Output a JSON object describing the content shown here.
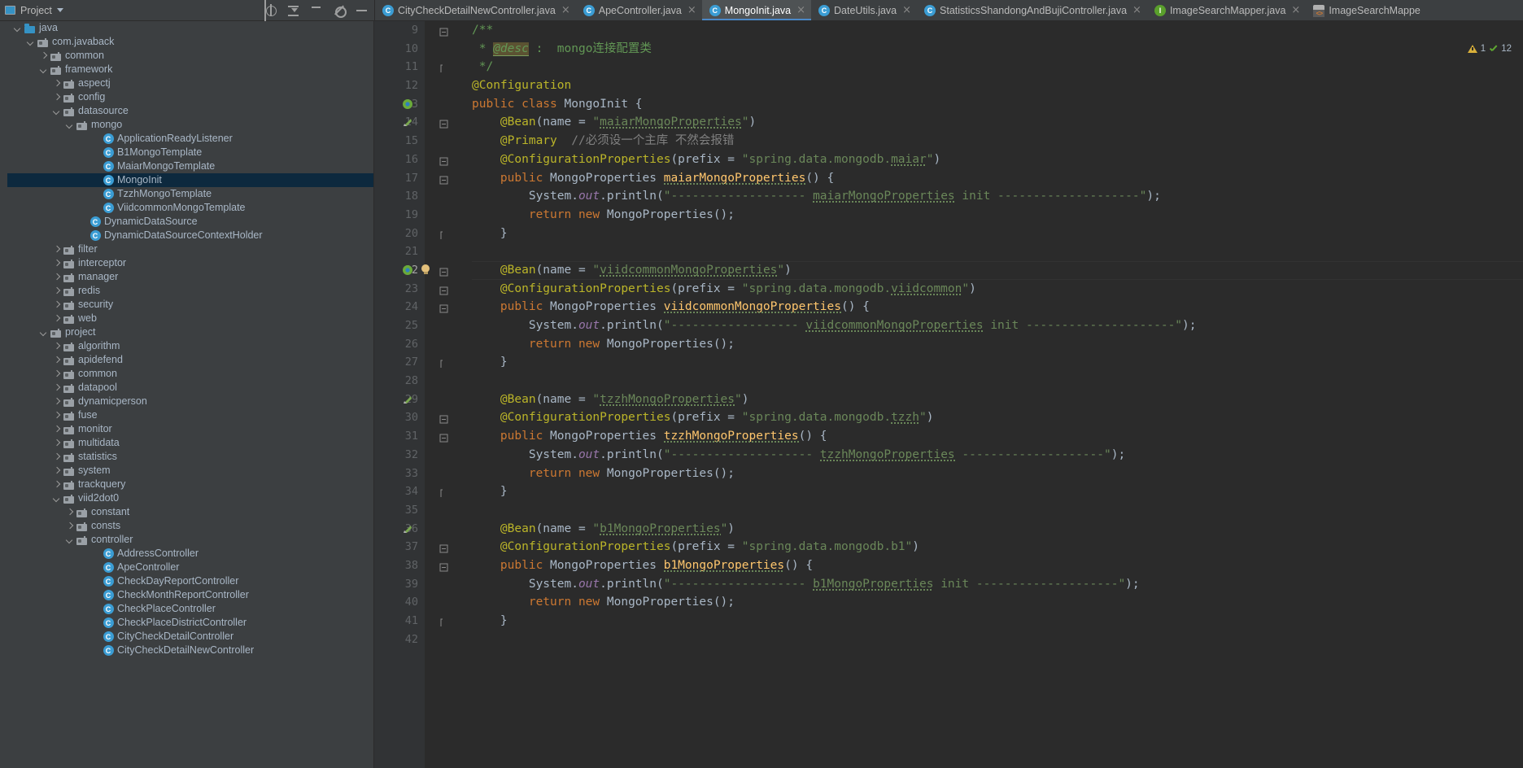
{
  "window": {
    "project_panel_title": "Project",
    "panel_icons": [
      "project-icon",
      "chevron-down-icon",
      "locate-icon",
      "collapse-all-icon",
      "sort-icon",
      "settings-gear-icon",
      "hide-icon"
    ]
  },
  "tabs": [
    {
      "label": "CityCheckDetailNewController.java",
      "icon": "class-icon",
      "icon_kind": "cls",
      "active": false
    },
    {
      "label": "ApeController.java",
      "icon": "class-icon",
      "icon_kind": "cls",
      "active": false
    },
    {
      "label": "MongoInit.java",
      "icon": "class-icon",
      "icon_kind": "cls",
      "active": true
    },
    {
      "label": "DateUtils.java",
      "icon": "class-icon",
      "icon_kind": "cls",
      "active": false
    },
    {
      "label": "StatisticsShandongAndBujiController.java",
      "icon": "class-icon",
      "icon_kind": "cls",
      "active": false
    },
    {
      "label": "ImageSearchMapper.java",
      "icon": "interface-icon",
      "icon_kind": "iface",
      "active": false
    },
    {
      "label": "ImageSearchMappe",
      "icon": "xml-file-icon",
      "icon_kind": "xml",
      "active": false
    }
  ],
  "inspection": {
    "warnings": "1",
    "checks": "12"
  },
  "tree": [
    {
      "label": "java",
      "indent": 3,
      "arrow": "down",
      "icon": "folder-src",
      "sel": false
    },
    {
      "label": "com.javaback",
      "indent": 4,
      "arrow": "down",
      "icon": "folder-pkg",
      "sel": false
    },
    {
      "label": "common",
      "indent": 5,
      "arrow": "right",
      "icon": "folder-pkg",
      "sel": false
    },
    {
      "label": "framework",
      "indent": 5,
      "arrow": "down",
      "icon": "folder-pkg",
      "sel": false
    },
    {
      "label": "aspectj",
      "indent": 6,
      "arrow": "right",
      "icon": "folder-pkg",
      "sel": false
    },
    {
      "label": "config",
      "indent": 6,
      "arrow": "right",
      "icon": "folder-pkg",
      "sel": false
    },
    {
      "label": "datasource",
      "indent": 6,
      "arrow": "down",
      "icon": "folder-pkg",
      "sel": false
    },
    {
      "label": "mongo",
      "indent": 7,
      "arrow": "down",
      "icon": "folder-pkg",
      "sel": false
    },
    {
      "label": "ApplicationReadyListener",
      "indent": 9,
      "arrow": "none",
      "icon": "class",
      "sel": false
    },
    {
      "label": "B1MongoTemplate",
      "indent": 9,
      "arrow": "none",
      "icon": "class",
      "sel": false
    },
    {
      "label": "MaiarMongoTemplate",
      "indent": 9,
      "arrow": "none",
      "icon": "class",
      "sel": false
    },
    {
      "label": "MongoInit",
      "indent": 9,
      "arrow": "none",
      "icon": "class",
      "sel": true
    },
    {
      "label": "TzzhMongoTemplate",
      "indent": 9,
      "arrow": "none",
      "icon": "class",
      "sel": false
    },
    {
      "label": "ViidcommonMongoTemplate",
      "indent": 9,
      "arrow": "none",
      "icon": "class",
      "sel": false
    },
    {
      "label": "DynamicDataSource",
      "indent": 8,
      "arrow": "none",
      "icon": "class",
      "sel": false
    },
    {
      "label": "DynamicDataSourceContextHolder",
      "indent": 8,
      "arrow": "none",
      "icon": "class",
      "sel": false
    },
    {
      "label": "filter",
      "indent": 6,
      "arrow": "right",
      "icon": "folder-pkg",
      "sel": false
    },
    {
      "label": "interceptor",
      "indent": 6,
      "arrow": "right",
      "icon": "folder-pkg",
      "sel": false
    },
    {
      "label": "manager",
      "indent": 6,
      "arrow": "right",
      "icon": "folder-pkg",
      "sel": false
    },
    {
      "label": "redis",
      "indent": 6,
      "arrow": "right",
      "icon": "folder-pkg",
      "sel": false
    },
    {
      "label": "security",
      "indent": 6,
      "arrow": "right",
      "icon": "folder-pkg",
      "sel": false
    },
    {
      "label": "web",
      "indent": 6,
      "arrow": "right",
      "icon": "folder-pkg",
      "sel": false
    },
    {
      "label": "project",
      "indent": 5,
      "arrow": "down",
      "icon": "folder-pkg",
      "sel": false
    },
    {
      "label": "algorithm",
      "indent": 6,
      "arrow": "right",
      "icon": "folder-pkg",
      "sel": false
    },
    {
      "label": "apidefend",
      "indent": 6,
      "arrow": "right",
      "icon": "folder-pkg",
      "sel": false
    },
    {
      "label": "common",
      "indent": 6,
      "arrow": "right",
      "icon": "folder-pkg",
      "sel": false
    },
    {
      "label": "datapool",
      "indent": 6,
      "arrow": "right",
      "icon": "folder-pkg",
      "sel": false
    },
    {
      "label": "dynamicperson",
      "indent": 6,
      "arrow": "right",
      "icon": "folder-pkg",
      "sel": false
    },
    {
      "label": "fuse",
      "indent": 6,
      "arrow": "right",
      "icon": "folder-pkg",
      "sel": false
    },
    {
      "label": "monitor",
      "indent": 6,
      "arrow": "right",
      "icon": "folder-pkg",
      "sel": false
    },
    {
      "label": "multidata",
      "indent": 6,
      "arrow": "right",
      "icon": "folder-pkg",
      "sel": false
    },
    {
      "label": "statistics",
      "indent": 6,
      "arrow": "right",
      "icon": "folder-pkg",
      "sel": false
    },
    {
      "label": "system",
      "indent": 6,
      "arrow": "right",
      "icon": "folder-pkg",
      "sel": false
    },
    {
      "label": "trackquery",
      "indent": 6,
      "arrow": "right",
      "icon": "folder-pkg",
      "sel": false
    },
    {
      "label": "viid2dot0",
      "indent": 6,
      "arrow": "down",
      "icon": "folder-pkg",
      "sel": false
    },
    {
      "label": "constant",
      "indent": 7,
      "arrow": "right",
      "icon": "folder-pkg",
      "sel": false
    },
    {
      "label": "consts",
      "indent": 7,
      "arrow": "right",
      "icon": "folder-pkg",
      "sel": false
    },
    {
      "label": "controller",
      "indent": 7,
      "arrow": "down",
      "icon": "folder-pkg",
      "sel": false
    },
    {
      "label": "AddressController",
      "indent": 9,
      "arrow": "none",
      "icon": "class",
      "sel": false
    },
    {
      "label": "ApeController",
      "indent": 9,
      "arrow": "none",
      "icon": "class",
      "sel": false
    },
    {
      "label": "CheckDayReportController",
      "indent": 9,
      "arrow": "none",
      "icon": "class",
      "sel": false
    },
    {
      "label": "CheckMonthReportController",
      "indent": 9,
      "arrow": "none",
      "icon": "class",
      "sel": false
    },
    {
      "label": "CheckPlaceController",
      "indent": 9,
      "arrow": "none",
      "icon": "class",
      "sel": false
    },
    {
      "label": "CheckPlaceDistrictController",
      "indent": 9,
      "arrow": "none",
      "icon": "class",
      "sel": false
    },
    {
      "label": "CityCheckDetailController",
      "indent": 9,
      "arrow": "none",
      "icon": "class",
      "sel": false
    },
    {
      "label": "CityCheckDetailNewController",
      "indent": 9,
      "arrow": "none",
      "icon": "class",
      "sel": false
    }
  ],
  "editor": {
    "file": "MongoInit.java",
    "first_line": 9,
    "lines": [
      {
        "n": 9,
        "fold": "top",
        "marker": "",
        "html": "<span class=\"doc\">/**</span>"
      },
      {
        "n": 10,
        "fold": "",
        "marker": "",
        "html": "<span class=\"doc\"> * </span><span class=\"hl-doctag\">@desc</span><span class=\"doc\"> :  mongo连接配置类</span>"
      },
      {
        "n": 11,
        "fold": "bottom",
        "marker": "",
        "html": "<span class=\"doc\"> */</span>"
      },
      {
        "n": 12,
        "fold": "",
        "marker": "",
        "html": "<span class=\"ann\">@Configuration</span>"
      },
      {
        "n": 13,
        "fold": "",
        "marker": "bean",
        "html": "<span class=\"kw\">public class </span><span class=\"txt\">MongoInit {</span>"
      },
      {
        "n": 14,
        "fold": "top",
        "marker": "override",
        "html": "<span class=\"txt\">    </span><span class=\"ann\">@Bean</span><span class=\"txt\">(name = </span><span class=\"str\">\"</span><span class=\"str spg\">maiarMongoProperties</span><span class=\"str\">\"</span><span class=\"txt\">)</span>"
      },
      {
        "n": 15,
        "fold": "",
        "marker": "",
        "html": "<span class=\"txt\">    </span><span class=\"ann\">@Primary</span><span class=\"txt\">  </span><span class=\"cmt\">//必须设一个主库 不然会报错</span>"
      },
      {
        "n": 16,
        "fold": "bracket",
        "marker": "",
        "html": "<span class=\"txt\">    </span><span class=\"ann\">@ConfigurationProperties</span><span class=\"txt\">(prefix = </span><span class=\"str\">\"spring.data.mongodb.</span><span class=\"str spg\">maiar</span><span class=\"str\">\"</span><span class=\"txt\">)</span>"
      },
      {
        "n": 17,
        "fold": "top",
        "marker": "",
        "html": "<span class=\"kw\">    public </span><span class=\"txt\">MongoProperties </span><span class=\"fn spg\">maiarMongoProperties</span><span class=\"txt\">() {</span>"
      },
      {
        "n": 18,
        "fold": "",
        "marker": "",
        "html": "<span class=\"txt\">        System.</span><span class=\"fld\">out</span><span class=\"txt\">.println(</span><span class=\"str\">\"------------------- </span><span class=\"str spg\">maiarMongoProperties</span><span class=\"str\"> init --------------------\"</span><span class=\"txt\">);</span>"
      },
      {
        "n": 19,
        "fold": "",
        "marker": "",
        "html": "<span class=\"txt\">        </span><span class=\"kw\">return new </span><span class=\"txt\">MongoProperties();</span>"
      },
      {
        "n": 20,
        "fold": "bottom",
        "marker": "",
        "html": "<span class=\"txt\">    }</span>"
      },
      {
        "n": 21,
        "fold": "",
        "marker": "",
        "html": ""
      },
      {
        "n": 22,
        "fold": "top",
        "marker": "bean-bulb",
        "html": "<span class=\"txt\">    </span><span class=\"ann\">@Bean</span><span class=\"txt\">(name = </span><span class=\"str\">\"</span><span class=\"str spg\">viidcommonMongoProperties</span><span class=\"str\">\"</span><span class=\"txt\">)</span>"
      },
      {
        "n": 23,
        "fold": "bracket",
        "marker": "",
        "html": "<span class=\"txt\">    </span><span class=\"ann\">@ConfigurationProperties</span><span class=\"txt\">(prefix = </span><span class=\"str\">\"spring.data.mongodb.</span><span class=\"str spg\">viidcommon</span><span class=\"str\">\"</span><span class=\"txt\">)</span>"
      },
      {
        "n": 24,
        "fold": "top",
        "marker": "",
        "html": "<span class=\"kw\">    public </span><span class=\"txt\">MongoProperties </span><span class=\"fn spg\">viidcommonMongoProperties</span><span class=\"txt\">() {</span>"
      },
      {
        "n": 25,
        "fold": "",
        "marker": "",
        "html": "<span class=\"txt\">        System.</span><span class=\"fld\">out</span><span class=\"txt\">.println(</span><span class=\"str\">\"------------------ </span><span class=\"str spg\">viidcommonMongoProperties</span><span class=\"str\"> init ---------------------\"</span><span class=\"txt\">);</span>"
      },
      {
        "n": 26,
        "fold": "",
        "marker": "",
        "html": "<span class=\"txt\">        </span><span class=\"kw\">return new </span><span class=\"txt\">MongoProperties();</span>"
      },
      {
        "n": 27,
        "fold": "bottom",
        "marker": "",
        "html": "<span class=\"txt\">    }</span>"
      },
      {
        "n": 28,
        "fold": "",
        "marker": "",
        "html": ""
      },
      {
        "n": 29,
        "fold": "",
        "marker": "override",
        "html": "<span class=\"txt\">    </span><span class=\"ann\">@Bean</span><span class=\"txt\">(name = </span><span class=\"str\">\"</span><span class=\"str spg\">tzzhMongoProperties</span><span class=\"str\">\"</span><span class=\"txt\">)</span>"
      },
      {
        "n": 30,
        "fold": "bracket",
        "marker": "",
        "html": "<span class=\"txt\">    </span><span class=\"ann\">@ConfigurationProperties</span><span class=\"txt\">(prefix = </span><span class=\"str\">\"spring.data.mongodb.</span><span class=\"str spg\">tzzh</span><span class=\"str\">\"</span><span class=\"txt\">)</span>"
      },
      {
        "n": 31,
        "fold": "top",
        "marker": "",
        "html": "<span class=\"kw\">    public </span><span class=\"txt\">MongoProperties </span><span class=\"fn spg\">tzzhMongoProperties</span><span class=\"txt\">() {</span>"
      },
      {
        "n": 32,
        "fold": "",
        "marker": "",
        "html": "<span class=\"txt\">        System.</span><span class=\"fld\">out</span><span class=\"txt\">.println(</span><span class=\"str\">\"-------------------- </span><span class=\"str spg\">tzzhMongoProperties</span><span class=\"str\"> --------------------\"</span><span class=\"txt\">);</span>"
      },
      {
        "n": 33,
        "fold": "",
        "marker": "",
        "html": "<span class=\"txt\">        </span><span class=\"kw\">return new </span><span class=\"txt\">MongoProperties();</span>"
      },
      {
        "n": 34,
        "fold": "bottom",
        "marker": "",
        "html": "<span class=\"txt\">    }</span>"
      },
      {
        "n": 35,
        "fold": "",
        "marker": "",
        "html": ""
      },
      {
        "n": 36,
        "fold": "",
        "marker": "override",
        "html": "<span class=\"txt\">    </span><span class=\"ann\">@Bean</span><span class=\"txt\">(name = </span><span class=\"str\">\"</span><span class=\"str spg\">b1MongoProperties</span><span class=\"str\">\"</span><span class=\"txt\">)</span>"
      },
      {
        "n": 37,
        "fold": "bracket",
        "marker": "",
        "html": "<span class=\"txt\">    </span><span class=\"ann\">@ConfigurationProperties</span><span class=\"txt\">(prefix = </span><span class=\"str\">\"spring.data.mongodb.b1\"</span><span class=\"txt\">)</span>"
      },
      {
        "n": 38,
        "fold": "top",
        "marker": "",
        "html": "<span class=\"kw\">    public </span><span class=\"txt\">MongoProperties </span><span class=\"fn spg\">b1MongoProperties</span><span class=\"txt\">() {</span>"
      },
      {
        "n": 39,
        "fold": "",
        "marker": "",
        "html": "<span class=\"txt\">        System.</span><span class=\"fld\">out</span><span class=\"txt\">.println(</span><span class=\"str\">\"------------------- </span><span class=\"str spg\">b1MongoProperties</span><span class=\"str\"> init --------------------\"</span><span class=\"txt\">);</span>"
      },
      {
        "n": 40,
        "fold": "",
        "marker": "",
        "html": "<span class=\"txt\">        </span><span class=\"kw\">return new </span><span class=\"txt\">MongoProperties();</span>"
      },
      {
        "n": 41,
        "fold": "bottom",
        "marker": "",
        "html": "<span class=\"txt\">    }</span>"
      },
      {
        "n": 42,
        "fold": "",
        "marker": "",
        "html": ""
      }
    ],
    "current_line": 22,
    "code_plain": [
      "/**",
      " * @desc :  mongo连接配置类",
      " */",
      "@Configuration",
      "public class MongoInit {",
      "    @Bean(name = \"maiarMongoProperties\")",
      "    @Primary  //必须设一个主库 不然会报错",
      "    @ConfigurationProperties(prefix = \"spring.data.mongodb.maiar\")",
      "    public MongoProperties maiarMongoProperties() {",
      "        System.out.println(\"------------------- maiarMongoProperties init --------------------\");",
      "        return new MongoProperties();",
      "    }",
      "",
      "    @Bean(name = \"viidcommonMongoProperties\")",
      "    @ConfigurationProperties(prefix = \"spring.data.mongodb.viidcommon\")",
      "    public MongoProperties viidcommonMongoProperties() {",
      "        System.out.println(\"------------------ viidcommonMongoProperties init ---------------------\");",
      "        return new MongoProperties();",
      "    }",
      "",
      "    @Bean(name = \"tzzhMongoProperties\")",
      "    @ConfigurationProperties(prefix = \"spring.data.mongodb.tzzh\")",
      "    public MongoProperties tzzhMongoProperties() {",
      "        System.out.println(\"-------------------- tzzhMongoProperties --------------------\");",
      "        return new MongoProperties();",
      "    }",
      "",
      "    @Bean(name = \"b1MongoProperties\")",
      "    @ConfigurationProperties(prefix = \"spring.data.mongodb.b1\")",
      "    public MongoProperties b1MongoProperties() {",
      "        System.out.println(\"------------------- b1MongoProperties init --------------------\");",
      "        return new MongoProperties();",
      "    }",
      ""
    ]
  },
  "colors": {
    "bg_editor": "#2b2b2b",
    "bg_panel": "#3c3f41",
    "bg_gutter": "#313335",
    "selection": "#0d293e",
    "accent_tab": "#4a88c7",
    "keyword": "#cc7832",
    "string": "#6a8759",
    "annotation": "#bbb529",
    "comment": "#808080",
    "javadoc": "#629755",
    "method": "#ffc66d",
    "field": "#9876aa",
    "text": "#a9b7c6"
  }
}
